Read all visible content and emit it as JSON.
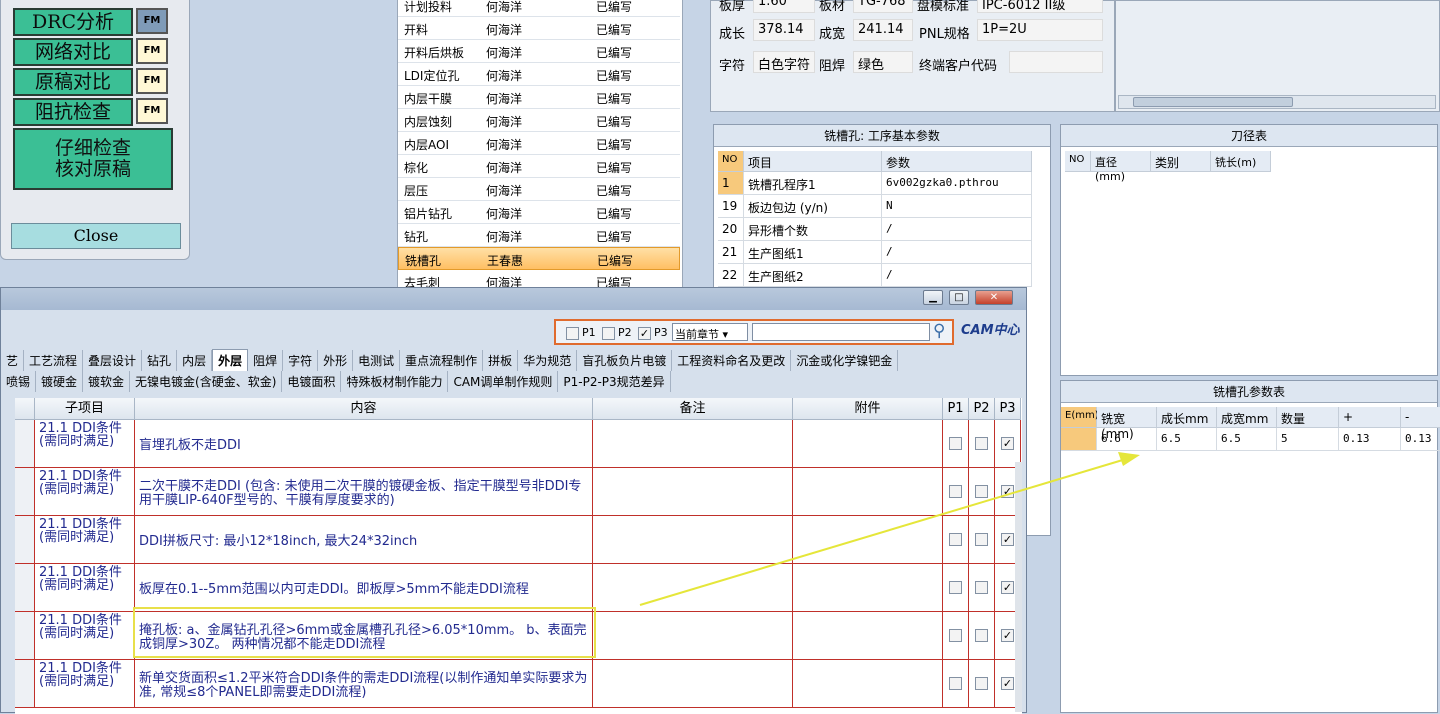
{
  "fm_panel": {
    "buttons": [
      "DRC分析",
      "网络对比",
      "原稿对比",
      "阻抗检查"
    ],
    "tag": "FM",
    "big_button": [
      "仔细检查",
      "核对原稿"
    ],
    "close": "Close"
  },
  "process_list": {
    "rows": [
      [
        "计划投料",
        "何海洋",
        "已编写"
      ],
      [
        "开料",
        "何海洋",
        "已编写"
      ],
      [
        "开料后烘板",
        "何海洋",
        "已编写"
      ],
      [
        "LDI定位孔",
        "何海洋",
        "已编写"
      ],
      [
        "内层干膜",
        "何海洋",
        "已编写"
      ],
      [
        "内层蚀刻",
        "何海洋",
        "已编写"
      ],
      [
        "内层AOI",
        "何海洋",
        "已编写"
      ],
      [
        "棕化",
        "何海洋",
        "已编写"
      ],
      [
        "层压",
        "何海洋",
        "已编写"
      ],
      [
        "铝片钻孔",
        "何海洋",
        "已编写"
      ],
      [
        "钻孔",
        "何海洋",
        "已编写"
      ],
      [
        "铣槽孔",
        "王春惠",
        "已编写"
      ],
      [
        "去毛刺",
        "何海洋",
        "已编写"
      ]
    ],
    "selected": 11
  },
  "info": {
    "row0": [
      "板厚",
      "1.60",
      "板材",
      "TG-768",
      "盘模标准",
      "IPC-6012 II级"
    ],
    "row1": [
      "成长",
      "378.14",
      "成宽",
      "241.14",
      "PNL规格",
      "1P=2U"
    ],
    "row2": [
      "字符",
      "白色字符",
      "阻焊",
      "绿色",
      "终端客户代码",
      ""
    ]
  },
  "params_panel": {
    "title": "铣槽孔: 工序基本参数",
    "headers": [
      "NO",
      "项目",
      "参数"
    ],
    "rows": [
      [
        "1",
        "铣槽孔程序1",
        "6v002gzka0.pthrou"
      ],
      [
        "19",
        "板边包边 (y/n)",
        "N"
      ],
      [
        "20",
        "异形槽个数",
        "/"
      ],
      [
        "21",
        "生产图纸1",
        "/"
      ],
      [
        "22",
        "生产图纸2",
        "/"
      ]
    ]
  },
  "tools_panel": {
    "title": "刀径表",
    "headers": [
      "NO",
      "直径(mm)",
      "类别",
      "铣长(m)"
    ]
  },
  "mill_params": {
    "title": "铣槽孔参数表",
    "headers": [
      "E(mm)",
      "铣宽(mm)",
      "成长mm",
      "成宽mm",
      "数量",
      "+",
      "-"
    ],
    "row": [
      "",
      "6.6",
      "6.5",
      "6.5",
      "5",
      "0.13",
      "0.13"
    ]
  },
  "main_window": {
    "filter": {
      "p1": "P1",
      "p2": "P2",
      "p3": "P3",
      "chapter": "当前章节",
      "logo": "CAM中心"
    },
    "tabs_row1": [
      "艺",
      "工艺流程",
      "叠层设计",
      "钻孔",
      "内层",
      "外层",
      "阻焊",
      "字符",
      "外形",
      "电测试",
      "重点流程制作",
      "拼板",
      "华为规范",
      "盲孔板负片电镀",
      "工程资料命名及更改",
      "沉金或化学镍钯金"
    ],
    "active_tab": "外层",
    "tabs_row2": [
      "喷锡",
      "镀硬金",
      "镀软金",
      "无镍电镀金(含硬金、软金)",
      "电镀面积",
      "特殊板材制作能力",
      "CAM调单制作规则",
      "P1-P2-P3规范差异"
    ],
    "grid_headers": [
      "子项目",
      "内容",
      "备注",
      "附件",
      "P1",
      "P2",
      "P3"
    ],
    "rows": [
      {
        "sub": "21.1 DDI条件(需同时满足)",
        "content": "盲埋孔板不走DDI",
        "p3": true
      },
      {
        "sub": "21.1 DDI条件(需同时满足)",
        "content": "二次干膜不走DDI (包含: 未使用二次干膜的镀硬金板、指定干膜型号非DDI专用干膜LIP-640F型号的、干膜有厚度要求的)",
        "p3": true
      },
      {
        "sub": "21.1 DDI条件(需同时满足)",
        "content": "DDI拼板尺寸: 最小12*18inch, 最大24*32inch",
        "p3": true
      },
      {
        "sub": "21.1 DDI条件(需同时满足)",
        "content": "板厚在0.1--5mm范围以内可走DDI。即板厚>5mm不能走DDI流程",
        "p3": true
      },
      {
        "sub": "21.1 DDI条件(需同时满足)",
        "content": "掩孔板: a、金属钻孔孔径>6mm或金属槽孔孔径>6.05*10mm。 b、表面完成铜厚>30Z。 两种情况都不能走DDI流程",
        "p3": true
      },
      {
        "sub": "21.1 DDI条件(需同时满足)",
        "content": "新单交货面积≤1.2平米符合DDI条件的需走DDI流程(以制作通知单实际要求为准, 常规≤8个PANEL即需要走DDI流程)",
        "p3": true
      }
    ]
  }
}
